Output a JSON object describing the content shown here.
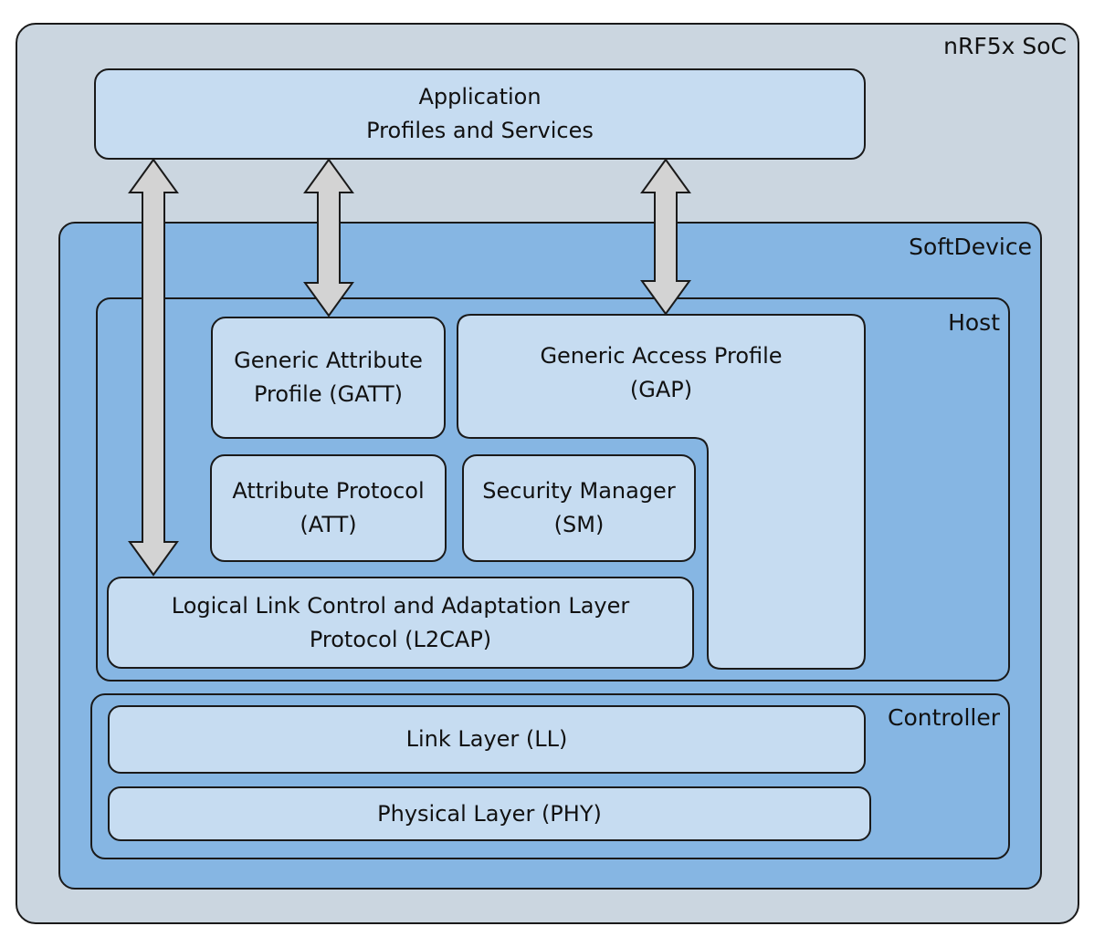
{
  "soc": {
    "label": "nRF5x SoC"
  },
  "application": {
    "line1": "Application",
    "line2": "Profiles and Services"
  },
  "softdevice": {
    "label": "SoftDevice"
  },
  "host": {
    "label": "Host",
    "gatt": {
      "line1": "Generic Attribute",
      "line2": "Profile (GATT)"
    },
    "gap": {
      "line1": "Generic Access Profile",
      "line2": "(GAP)"
    },
    "att": {
      "line1": "Attribute Protocol",
      "line2": "(ATT)"
    },
    "sm": {
      "line1": "Security Manager",
      "line2": "(SM)"
    },
    "l2cap": {
      "line1": "Logical Link Control and Adaptation Layer",
      "line2": "Protocol (L2CAP)"
    }
  },
  "controller": {
    "label": "Controller",
    "ll": {
      "label": "Link Layer (LL)"
    },
    "phy": {
      "label": "Physical Layer (PHY)"
    }
  },
  "colors": {
    "soc_fill": "#cbd6e0",
    "softdevice_fill": "#86b6e3",
    "block_fill": "#c6dcf1",
    "arrow_fill": "#d3d3d3",
    "outline": "#1a1a1a"
  }
}
